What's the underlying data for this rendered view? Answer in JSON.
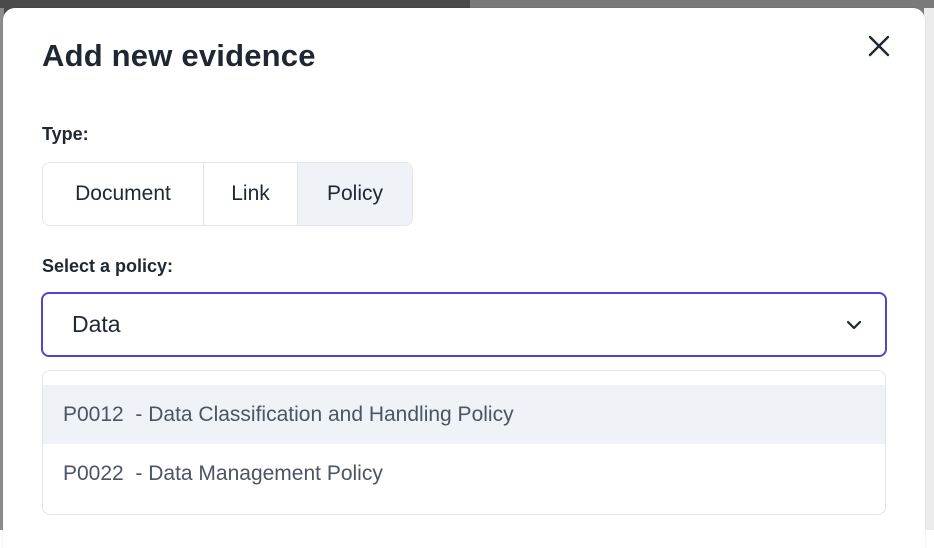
{
  "modal": {
    "title": "Add new evidence",
    "close_icon": "close-icon"
  },
  "type_field": {
    "label": "Type:",
    "options": [
      "Document",
      "Link",
      "Policy"
    ],
    "selected": "Policy"
  },
  "policy_field": {
    "label": "Select a policy:",
    "value": "Data",
    "chevron_icon": "chevron-down-icon",
    "options": [
      "P0012  - Data Classification and Handling Policy",
      "P0022  - Data Management Policy"
    ],
    "highlighted_index": 0
  },
  "colors": {
    "focus_border": "#5b3fd0",
    "selected_segment_bg": "#eff2f6",
    "highlighted_option_bg": "#eff2f6",
    "title_text": "#1f2733",
    "option_text": "#4b5563"
  }
}
